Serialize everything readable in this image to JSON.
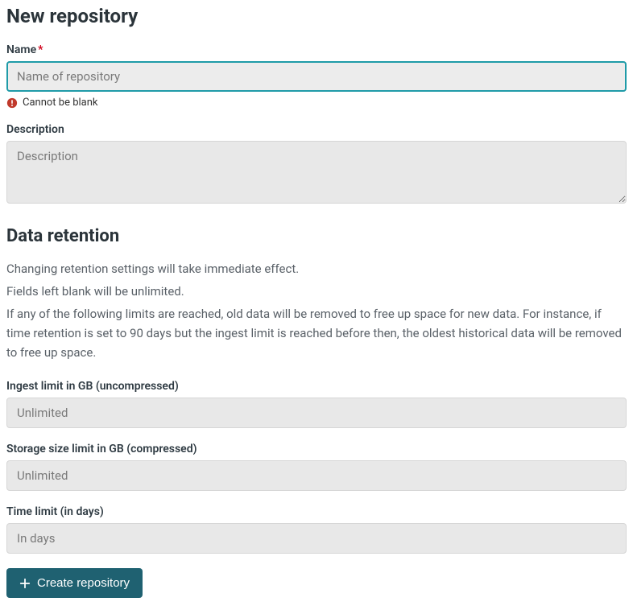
{
  "page": {
    "title": "New repository"
  },
  "fields": {
    "name": {
      "label": "Name",
      "required_marker": "*",
      "placeholder": "Name of repository",
      "value": "",
      "error": "Cannot be blank"
    },
    "description": {
      "label": "Description",
      "placeholder": "Description",
      "value": ""
    }
  },
  "retention": {
    "title": "Data retention",
    "help1": "Changing retention settings will take immediate effect.",
    "help2": "Fields left blank will be unlimited.",
    "help3": "If any of the following limits are reached, old data will be removed to free up space for new data. For instance, if time retention is set to 90 days but the ingest limit is reached before then, the oldest historical data will be removed to free up space.",
    "ingest": {
      "label": "Ingest limit in GB (uncompressed)",
      "placeholder": "Unlimited",
      "value": ""
    },
    "storage": {
      "label": "Storage size limit in GB (compressed)",
      "placeholder": "Unlimited",
      "value": ""
    },
    "time": {
      "label": "Time limit (in days)",
      "placeholder": "In days",
      "value": ""
    }
  },
  "actions": {
    "create_label": "Create repository"
  }
}
